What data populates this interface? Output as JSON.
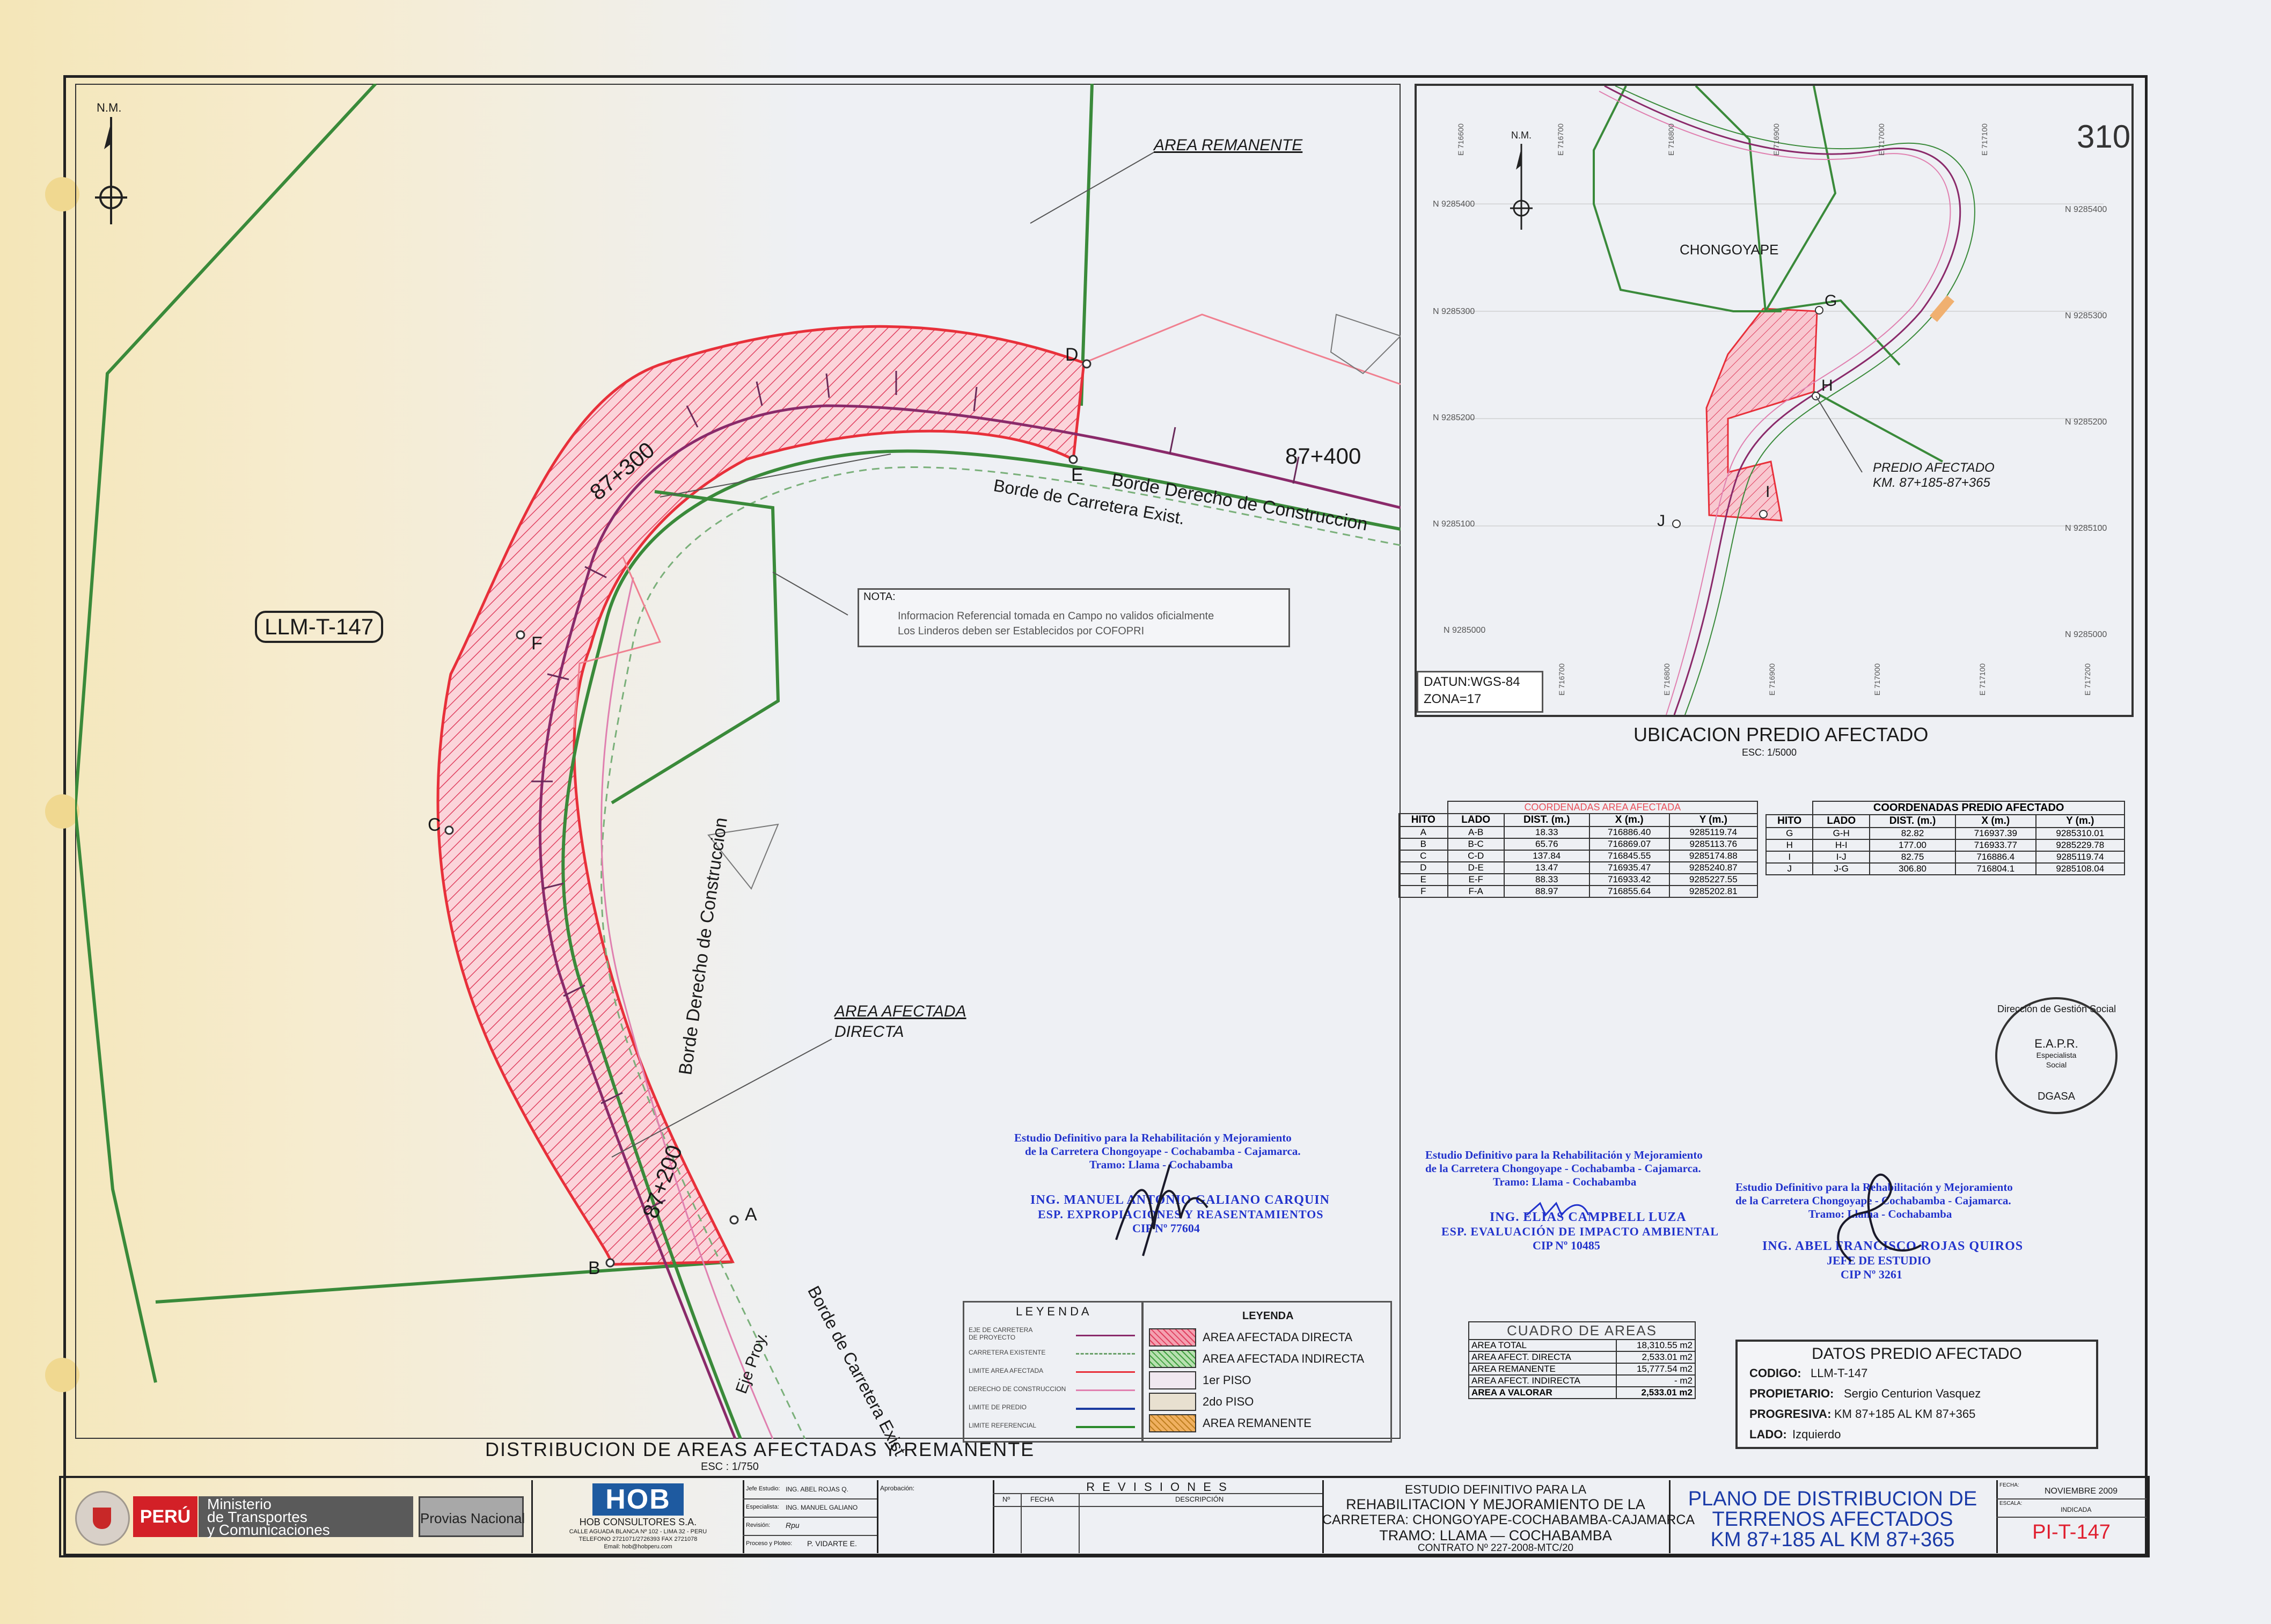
{
  "sheet": {
    "lot_code_tag": "LLM-T-147",
    "north_label": "N.M.",
    "sheet_number_mark": "310"
  },
  "map_labels": {
    "area_remanente": "AREA REMANENTE",
    "area_afectada_directa_line1": "AREA AFECTADA",
    "area_afectada_directa_line2": "DIRECTA",
    "borde_derecho_construccion": "Borde Derecho de Construccion",
    "borde_carretera_exist": "Borde de Carretera Exist.",
    "borde_derecho_construccion_vertical": "Borde Derecho de Construccion",
    "borde_carretera_exist_vertical": "Borde de Carretera Exist",
    "eje_proyectado": "Eje Proy.",
    "stations": [
      "87+300",
      "87+400",
      "87+200"
    ],
    "points": [
      "A",
      "B",
      "C",
      "D",
      "E",
      "F"
    ]
  },
  "nota": {
    "title": "NOTA:",
    "line1": "Informacion Referencial tomada en Campo no validos oficialmente",
    "line2": "Los Linderos deben ser Establecidos por COFOPRI"
  },
  "main_map_title": {
    "title": "DISTRIBUCION DE AREAS AFECTADAS Y REMANENTE",
    "scale": "ESC : 1/750"
  },
  "location_map": {
    "north_label": "N.M.",
    "town": "CHONGOYAPE",
    "predio_label_line1": "PREDIO AFECTADO",
    "predio_label_line2": "KM. 87+185-87+365",
    "points": [
      "G",
      "H",
      "I",
      "J"
    ],
    "datum_line1": "DATUN:WGS-84",
    "datum_line2": "ZONA=17",
    "northings_left": [
      "N 9285400",
      "N 9285300",
      "N 9285200",
      "N 9285100",
      "N 9285000"
    ],
    "northings_right": [
      "N 9285400",
      "N 9285300",
      "N 9285200",
      "N 9285100",
      "N 9285000"
    ],
    "eastings_top": [
      "E 716600",
      "E 716700",
      "E 716800",
      "E 716900",
      "E 717000",
      "E 717100"
    ],
    "eastings_bottom": [
      "E 716700",
      "E 716800",
      "E 716900",
      "E 717000",
      "E 717100",
      "E 717200"
    ],
    "title": "UBICACION PREDIO AFECTADO",
    "scale": "ESC: 1/5000"
  },
  "coords_area_afectada": {
    "title": "COORDENADAS AREA AFECTADA",
    "headers": [
      "HITO",
      "LADO",
      "DIST. (m.)",
      "X (m.)",
      "Y (m.)"
    ],
    "rows": [
      [
        "A",
        "A-B",
        "18.33",
        "716886.40",
        "9285119.74"
      ],
      [
        "B",
        "B-C",
        "65.76",
        "716869.07",
        "9285113.76"
      ],
      [
        "C",
        "C-D",
        "137.84",
        "716845.55",
        "9285174.88"
      ],
      [
        "D",
        "D-E",
        "13.47",
        "716935.47",
        "9285240.87"
      ],
      [
        "E",
        "E-F",
        "88.33",
        "716933.42",
        "9285227.55"
      ],
      [
        "F",
        "F-A",
        "88.97",
        "716855.64",
        "9285202.81"
      ]
    ]
  },
  "coords_predio_afectado": {
    "title": "COORDENADAS PREDIO AFECTADO",
    "headers": [
      "HITO",
      "LADO",
      "DIST. (m.)",
      "X (m.)",
      "Y (m.)"
    ],
    "rows": [
      [
        "G",
        "G-H",
        "82.82",
        "716937.39",
        "9285310.01"
      ],
      [
        "H",
        "H-I",
        "177.00",
        "716933.77",
        "9285229.78"
      ],
      [
        "I",
        "I-J",
        "82.75",
        "716886.4",
        "9285119.74"
      ],
      [
        "J",
        "J-G",
        "306.80",
        "716804.1",
        "9285108.04"
      ]
    ]
  },
  "stamp": {
    "ring_text": "Dirección de Gestión Social",
    "center1": "E.A.P.R.",
    "center2": "Especialista",
    "center3": "Social",
    "bottom": "DGASA"
  },
  "signatures": [
    {
      "study1": "Estudio Definitivo para la Rehabilitación y Mejoramiento",
      "study2": "de la Carretera Chongoyape - Cochabamba - Cajamarca.",
      "study3": "Tramo: Llama - Cochabamba",
      "name": "ING. MANUEL ANTONIO GALIANO CARQUIN",
      "role": "ESP. EXPROPIACIONES Y REASENTAMIENTOS",
      "cip": "CIP Nº 77604"
    },
    {
      "study1": "Estudio Definitivo para la Rehabilitación y Mejoramiento",
      "study2": "de la Carretera Chongoyape - Cochabamba - Cajamarca.",
      "study3": "Tramo: Llama - Cochabamba",
      "name": "ING. ELIAS CAMPBELL LUZA",
      "role": "ESP. EVALUACIÓN DE IMPACTO AMBIENTAL",
      "cip": "CIP Nº 10485"
    },
    {
      "study1": "Estudio Definitivo para la Rehabilitación y Mejoramiento",
      "study2": "de la Carretera Chongoyape - Cochabamba - Cajamarca.",
      "study3": "Tramo: Llama - Cochabamba",
      "name": "ING. ABEL FRANCISCO ROJAS QUIROS",
      "role": "JEFE DE ESTUDIO",
      "cip": "CIP Nº 3261"
    }
  ],
  "legend_lines": {
    "title": "L E Y E N D A",
    "items": [
      {
        "label1": "EJE DE CARRETERA",
        "label2": "DE PROYECTO",
        "color": "#8a2a6a"
      },
      {
        "label1": "CARRETERA EXISTENTE",
        "label2": "",
        "color": "#6aa06a"
      },
      {
        "label1": "LIMITE AREA AFECTADA",
        "label2": "",
        "color": "#e8303a"
      },
      {
        "label1": "DERECHO DE CONSTRUCCION",
        "label2": "",
        "color": "#e080b0"
      },
      {
        "label1": "LIMITE DE PREDIO",
        "label2": "",
        "color": "#1a3aa0"
      },
      {
        "label1": "LIMITE REFERENCIAL",
        "label2": "",
        "color": "#2a8a2a"
      }
    ]
  },
  "legend_fills": {
    "title": "LEYENDA",
    "items": [
      {
        "label": "AREA AFECTADA DIRECTA",
        "color": "#f4a0b0",
        "hatch": "#e04060"
      },
      {
        "label": "AREA AFECTADA INDIRECTA",
        "color": "#b8e0b0",
        "hatch": "#40a040"
      },
      {
        "label": "1er PISO",
        "color": "#f0e8f0",
        "hatch": ""
      },
      {
        "label": "2do PISO",
        "color": "#e8e0d0",
        "hatch": ""
      },
      {
        "label": "AREA REMANENTE",
        "color": "#f0b060",
        "hatch": "#c08020"
      }
    ]
  },
  "cuadro_areas": {
    "title": "CUADRO DE AREAS",
    "rows": [
      [
        "AREA TOTAL",
        "18,310.55 m2"
      ],
      [
        "AREA AFECT. DIRECTA",
        "2,533.01 m2"
      ],
      [
        "AREA REMANENTE",
        "15,777.54 m2"
      ],
      [
        "AREA AFECT. INDIRECTA",
        "- m2"
      ],
      [
        "AREA A VALORAR",
        "2,533.01 m2"
      ]
    ]
  },
  "datos_predio": {
    "title": "DATOS PREDIO AFECTADO",
    "codigo_label": "CODIGO:",
    "codigo_value": "LLM-T-147",
    "propietario_label": "PROPIETARIO:",
    "propietario_value": "Sergio Centurion Vasquez",
    "progresiva_label": "PROGRESIVA:",
    "progresiva_value": "KM 87+185 AL KM 87+365",
    "lado_label": "LADO:",
    "lado_value": "Izquierdo"
  },
  "title_block": {
    "peru": "PERÚ",
    "ministerio_line1": "Ministerio",
    "ministerio_line2": "de Transportes",
    "ministerio_line3": "y Comunicaciones",
    "provias": "Provias Nacional",
    "hob_logo": "HOB",
    "hob_name": "HOB CONSULTORES S.A.",
    "hob_addr1": "CALLE AGUADA BLANCA Nº 102 - LIMA 32 - PERU",
    "hob_addr2": "TELEFONO 2721071/2726393 FAX 2721078",
    "hob_email": "Email: hob@hobperu.com",
    "jefe_label": "Jefe Estudio:",
    "jefe_value": "ING. ABEL ROJAS Q.",
    "esp_label": "Especialista:",
    "esp_value": "ING. MANUEL GALIANO",
    "rev_label": "Revisión:",
    "rev_value": "Rpu",
    "proc_label": "Proceso y Ploteo:",
    "proc_value": "P. VIDARTE E.",
    "aprob_label": "Aprobación:",
    "revisiones_title": "R E V I S I O N E S",
    "rev_headers": [
      "Nº",
      "FECHA",
      "DESCRIPCIÓN"
    ],
    "study_line1": "ESTUDIO DEFINITIVO PARA LA",
    "study_line2": "REHABILITACION Y MEJORAMIENTO DE LA",
    "study_line3": "CARRETERA: CHONGOYAPE-COCHABAMBA-CAJAMARCA",
    "study_line4": "TRAMO: LLAMA — COCHABAMBA",
    "contrato": "CONTRATO Nº 227-2008-MTC/20",
    "plan_line1": "PLANO DE DISTRIBUCION DE",
    "plan_line2": "TERRENOS AFECTADOS",
    "plan_line3": "KM 87+185 AL KM 87+365",
    "fecha_label": "FECHA:",
    "fecha_value": "NOVIEMBRE 2009",
    "escala_label": "ESCALA:",
    "escala_value": "INDICADA",
    "plano_code": "PI-T-147"
  }
}
